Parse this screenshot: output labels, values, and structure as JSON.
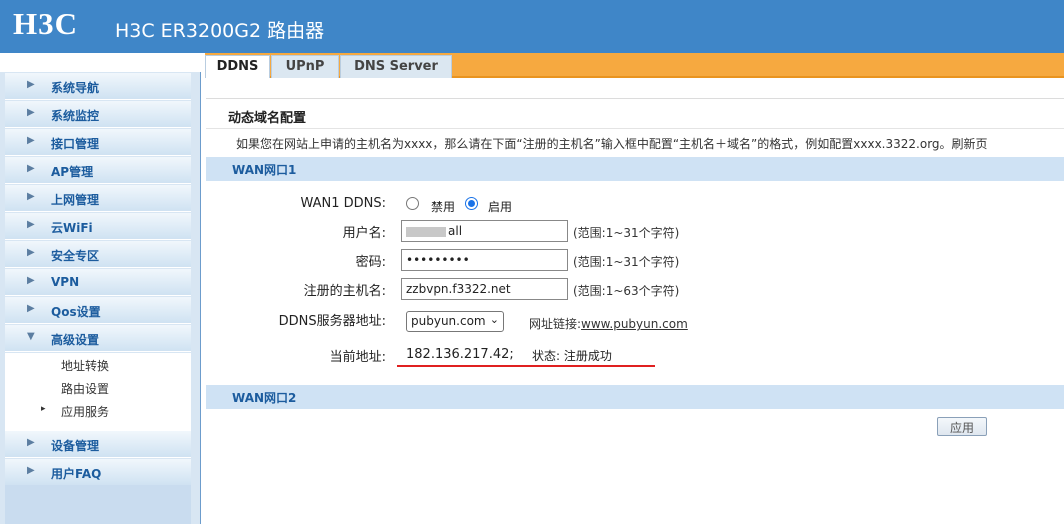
{
  "header": {
    "logo": "H3C",
    "title": "H3C ER3200G2 路由器"
  },
  "sidebar": {
    "items": [
      {
        "label": "系统导航"
      },
      {
        "label": "系统监控"
      },
      {
        "label": "接口管理"
      },
      {
        "label": "AP管理"
      },
      {
        "label": "上网管理"
      },
      {
        "label": "云WiFi"
      },
      {
        "label": "安全专区"
      },
      {
        "label": "VPN"
      },
      {
        "label": "Qos设置"
      },
      {
        "label": "高级设置"
      },
      {
        "label": "设备管理"
      },
      {
        "label": "用户FAQ"
      }
    ],
    "subitems": [
      {
        "label": "地址转换"
      },
      {
        "label": "路由设置"
      },
      {
        "label": "应用服务"
      }
    ]
  },
  "tabs": [
    {
      "label": "DDNS"
    },
    {
      "label": "UPnP"
    },
    {
      "label": "DNS Server"
    }
  ],
  "section": {
    "title": "动态域名配置",
    "description": "如果您在网站上申请的主机名为xxxx，那么请在下面“注册的主机名”输入框中配置“主机名＋域名”的格式，例如配置xxxx.3322.org。刷新页"
  },
  "wan1": {
    "title": "WAN网口1",
    "ddns_label": "WAN1 DDNS:",
    "disable_label": "禁用",
    "enable_label": "启用",
    "username_label": "用户名:",
    "username_value": "all",
    "username_hint": "(范围:1~31个字符)",
    "password_label": "密码:",
    "password_value": "•••••••••",
    "password_hint": "(范围:1~31个字符)",
    "hostname_label": "注册的主机名:",
    "hostname_value": "zzbvpn.f3322.net",
    "hostname_hint": "(范围:1~63个字符)",
    "server_label": "DDNS服务器地址:",
    "server_value": "pubyun.com",
    "link_prefix": "网址链接:",
    "link_text": "www.pubyun.com",
    "addr_label": "当前地址:",
    "addr_value": "182.136.217.42;",
    "status_text": "状态: 注册成功"
  },
  "wan2": {
    "title": "WAN网口2"
  },
  "apply_label": "应用",
  "colors": {
    "header": "#3f86c8",
    "tab_bar": "#f6a940",
    "accent_text": "#1c5c9e",
    "highlight": "#e02020"
  }
}
